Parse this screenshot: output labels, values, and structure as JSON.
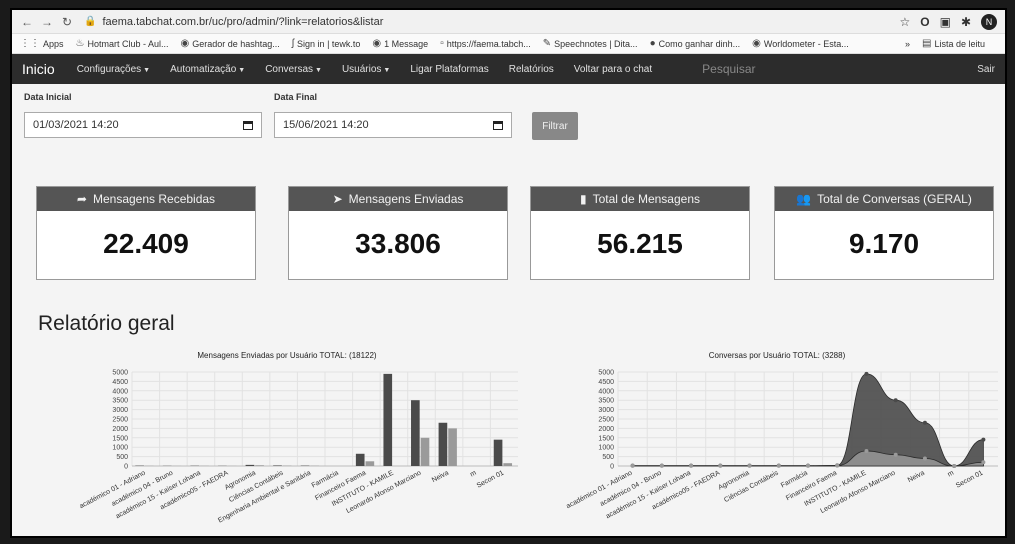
{
  "browser": {
    "url": "faema.tabchat.com.br/uc/pro/admin/?link=relatorios&listar",
    "bookmarks": [
      "Apps",
      "Hotmart Club - Aul...",
      "Gerador de hashtag...",
      "Sign in | tewk.to",
      "1 Message",
      "https://faema.tabch...",
      "Speechnotes | Dita...",
      "Como ganhar dinh...",
      "Worldometer - Esta..."
    ],
    "bookmarks_more": "»",
    "reading_list": "Lista de leitu",
    "profile_initial": "N"
  },
  "navbar": {
    "brand": "Inicio",
    "items": [
      "Configurações",
      "Automatização",
      "Conversas",
      "Usuários",
      "Ligar Plataformas",
      "Relatórios",
      "Voltar para o chat"
    ],
    "dropdown_flags": [
      true,
      true,
      true,
      true,
      false,
      false,
      false
    ],
    "search_placeholder": "Pesquisar",
    "logout": "Sair"
  },
  "filters": {
    "start_label": "Data Inicial",
    "start_value": "01/03/2021 14:20",
    "end_label": "Data Final",
    "end_value": "15/06/2021 14:20",
    "filter_button": "Filtrar"
  },
  "stats": [
    {
      "label": "Mensagens Recebidas",
      "value": "22.409",
      "icon": "share-icon"
    },
    {
      "label": "Mensagens Enviadas",
      "value": "33.806",
      "icon": "paper-plane-icon"
    },
    {
      "label": "Total de Mensagens",
      "value": "56.215",
      "icon": "book-icon"
    },
    {
      "label": "Total de Conversas (GERAL)",
      "value": "9.170",
      "icon": "users-icon"
    }
  ],
  "section_title": "Relatório geral",
  "colors": {
    "bar_dark": "#4a4a4a",
    "bar_light": "#9a9a9a",
    "grid": "#e2e2e2",
    "navbar": "#2c2c2c",
    "card_head": "#555555"
  },
  "chart_data": [
    {
      "type": "bar",
      "title": "Mensagens Enviadas por Usuário    TOTAL: (18122)",
      "ylim": [
        0,
        5000
      ],
      "yticks": [
        0,
        500,
        1000,
        1500,
        2000,
        2500,
        3000,
        3500,
        4000,
        4500,
        5000
      ],
      "categories": [
        "académico 01 - Adriano",
        "académico 04 - Bruno",
        "académico 15 - Kaiser Lohana",
        "académico05 - FAEDRA",
        "Agronomia",
        "Ciências Contábeis",
        "Engenharia Ambiental e Sanitária",
        "Farmácia",
        "Financeiro Faema",
        "INSTITUTO - KAMILE",
        "Leonardo Afonso Marciano",
        "Neiva",
        "m",
        "Secon 01"
      ],
      "series": [
        {
          "values": [
            20,
            10,
            15,
            10,
            60,
            30,
            20,
            0,
            650,
            4900,
            3500,
            2300,
            0,
            1400
          ]
        },
        {
          "values": [
            10,
            5,
            10,
            5,
            40,
            20,
            15,
            0,
            250,
            0,
            1500,
            2000,
            0,
            150
          ]
        }
      ],
      "grid": true
    },
    {
      "type": "area",
      "title": "Conversas por Usuário    TOTAL: (3288)",
      "ylim": [
        0,
        5000
      ],
      "yticks": [
        0,
        500,
        1000,
        1500,
        2000,
        2500,
        3000,
        3500,
        4000,
        4500,
        5000
      ],
      "categories": [
        "académico 01 - Adriano",
        "académico 04 - Bruno",
        "académico 15 - Kaiser Lohana",
        "académico05 - FAEDRA",
        "Agronomia",
        "Ciências Contábeis",
        "Farmácia",
        "Financeiro Faema",
        "INSTITUTO - KAMILE",
        "Leonardo Afonso Marciano",
        "Neiva",
        "m",
        "Secon 01"
      ],
      "series": [
        {
          "values": [
            20,
            20,
            20,
            20,
            20,
            20,
            20,
            30,
            4900,
            3500,
            2300,
            0,
            1400
          ]
        },
        {
          "values": [
            10,
            10,
            10,
            10,
            10,
            10,
            10,
            20,
            800,
            600,
            400,
            0,
            200
          ]
        }
      ],
      "grid": true
    }
  ]
}
